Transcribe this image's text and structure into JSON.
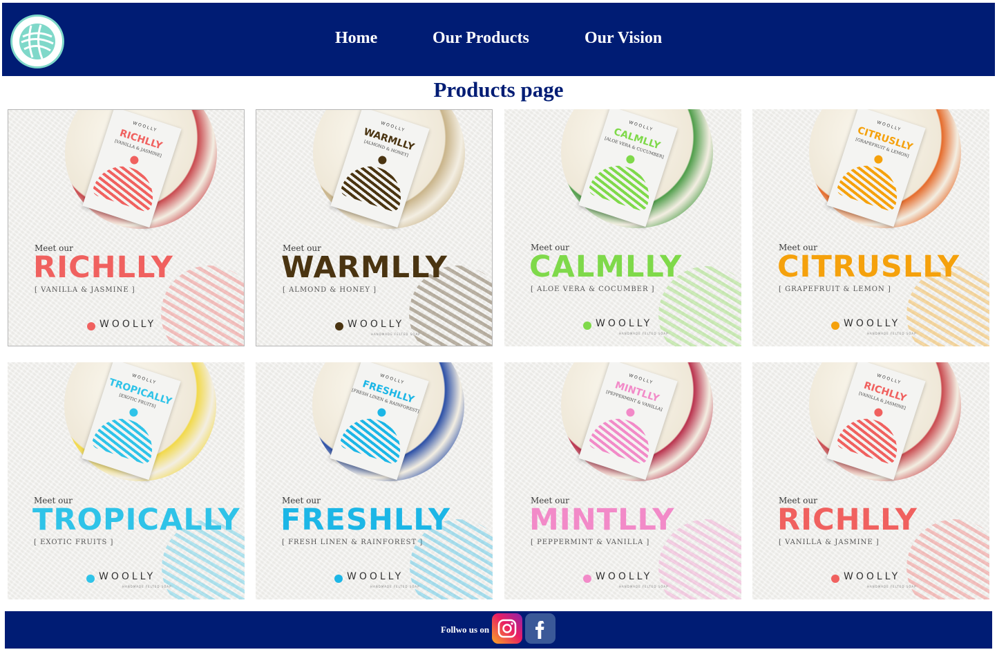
{
  "header": {
    "nav": [
      {
        "label": "Home"
      },
      {
        "label": "Our Products"
      },
      {
        "label": "Our Vision"
      }
    ],
    "logo_icon": "yarn-ball-logo-icon"
  },
  "page_title": "Products page",
  "products": [
    {
      "meet": "Meet our",
      "name": "RICHLLY",
      "scent": "[ VANILLA & JASMINE ]",
      "tag_name": "RICHLLY",
      "tag_scent": "[VANILLA & JASMINE]",
      "color": "#f0615f",
      "felt": "#c94a4f",
      "brand": "WOOLLY",
      "brand_sub": "",
      "bordered": true
    },
    {
      "meet": "Meet our",
      "name": "WARMLLY",
      "scent": "[ ALMOND & HONEY ]",
      "tag_name": "WARMLLY",
      "tag_scent": "[ALMOND & HONEY]",
      "color": "#4a3411",
      "felt": "#c9b48a",
      "brand": "WOOLLY",
      "brand_sub": "HANDMADE FELTED SOAP",
      "bordered": true
    },
    {
      "meet": "Meet our",
      "name": "CALMLLY",
      "scent": "[ ALOE VERA & COCUMBER ]",
      "tag_name": "CALMLLY",
      "tag_scent": "[ALOE VERA & CUCUMBER]",
      "color": "#7fd94a",
      "felt": "#4f9d4a",
      "brand": "WOOLLY",
      "brand_sub": "HANDMADE FELTED SOAP",
      "bordered": false
    },
    {
      "meet": "Meet our",
      "name": "CITRUSLLY",
      "scent": "[ GRAPEFRUIT & LEMON ]",
      "tag_name": "CITRUSLLY",
      "tag_scent": "[GRAPEFRUIT & LEMON]",
      "color": "#f5a10c",
      "felt": "#e56b2b",
      "brand": "WOOLLY",
      "brand_sub": "HANDMADE FELTED SOAP",
      "bordered": false
    },
    {
      "meet": "Meet our",
      "name": "TROPICALLY",
      "scent": "[ EXOTIC FRUITS ]",
      "tag_name": "TROPICALLY",
      "tag_scent": "[EXOTIC FRUITS]",
      "color": "#2fc3e8",
      "felt": "#f2d94a",
      "brand": "WOOLLY",
      "brand_sub": "HANDMADE FELTED SOAP",
      "bordered": false
    },
    {
      "meet": "Meet our",
      "name": "FRESHLLY",
      "scent": "[ FRESH LINEN & RAINFOREST ]",
      "tag_name": "FRESHLLY",
      "tag_scent": "[FRESH LINEN & RAINFOREST]",
      "color": "#1cb6e6",
      "felt": "#2b4fa6",
      "brand": "WOOLLY",
      "brand_sub": "HANDMADE FELTED SOAP",
      "bordered": false
    },
    {
      "meet": "Meet our",
      "name": "MINTLLY",
      "scent": "[ PEPPERMINT & VANILLA ]",
      "tag_name": "MINTLLY",
      "tag_scent": "[PEPPERMINT & VANILLA]",
      "color": "#f28ac8",
      "felt": "#b9324d",
      "brand": "WOOLLY",
      "brand_sub": "HANDMADE FELTED SOAP",
      "bordered": false
    },
    {
      "meet": "Meet our",
      "name": "RICHLLY",
      "scent": "[ VANILLA & JASMINE ]",
      "tag_name": "RICHLLY",
      "tag_scent": "[VANILLA & JASMINE]",
      "color": "#f0615f",
      "felt": "#c94a4f",
      "brand": "WOOLLY",
      "brand_sub": "HANDMADE FELTED SOAP",
      "bordered": false
    }
  ],
  "footer": {
    "follow_text": "Follwo us on",
    "instagram_icon": "instagram-icon",
    "facebook_icon": "facebook-icon"
  }
}
